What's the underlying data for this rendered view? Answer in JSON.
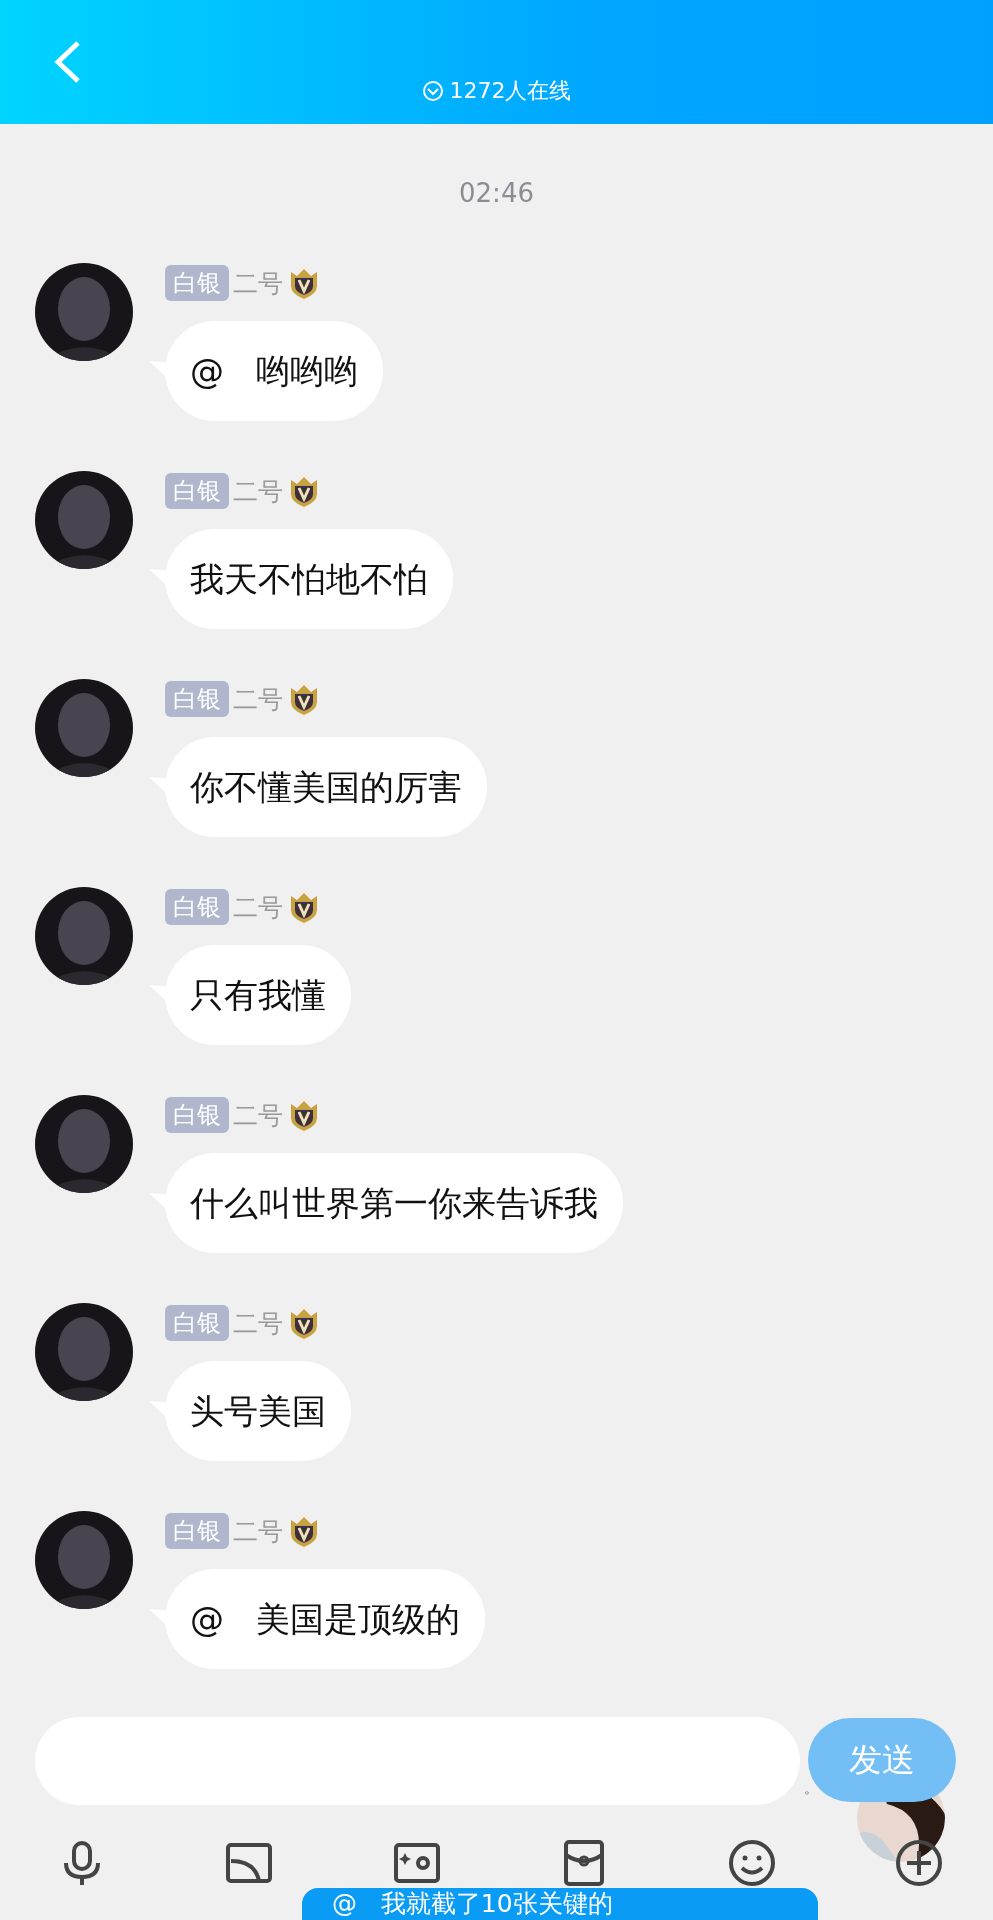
{
  "header": {
    "online_count": "1272人在线"
  },
  "timestamp": "02:46",
  "messages": [
    {
      "badge": "白银",
      "sender": "二号",
      "text": "@   哟哟哟"
    },
    {
      "badge": "白银",
      "sender": "二号",
      "text": "我天不怕地不怕"
    },
    {
      "badge": "白银",
      "sender": "二号",
      "text": "你不懂美国的厉害"
    },
    {
      "badge": "白银",
      "sender": "二号",
      "text": "只有我懂"
    },
    {
      "badge": "白银",
      "sender": "二号",
      "text": "什么叫世界第一你来告诉我"
    },
    {
      "badge": "白银",
      "sender": "二号",
      "text": "头号美国"
    },
    {
      "badge": "白银",
      "sender": "二号",
      "text": "@   美国是顶级的"
    }
  ],
  "input": {
    "suffix": "。"
  },
  "send_button": "发送",
  "toolbar": [
    {
      "kind": "mic"
    },
    {
      "kind": "screen"
    },
    {
      "kind": "photo"
    },
    {
      "kind": "packet"
    },
    {
      "kind": "emoji"
    },
    {
      "kind": "plus"
    }
  ],
  "floating_message": {
    "text": "@   我就截了10张关键的"
  }
}
